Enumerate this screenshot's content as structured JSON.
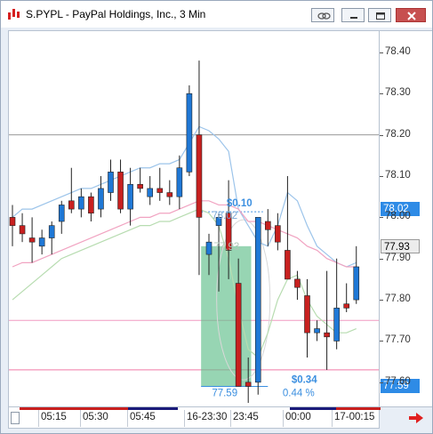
{
  "window": {
    "title": "S.PYPL - PayPal Holdings, Inc., 3 Min",
    "buttons": [
      "link-icon",
      "minimize-icon",
      "restore-icon",
      "close-icon"
    ]
  },
  "price_axis": {
    "ticks": [
      "78.40",
      "78.30",
      "78.20",
      "78.10",
      "78.00",
      "77.90",
      "77.80",
      "77.70",
      "77.60"
    ],
    "tags": {
      "blue_level": "78.02",
      "last_price": "77.93",
      "measure_low": "77.59"
    }
  },
  "time_axis": {
    "labels": [
      "05:15",
      "05:30",
      "05:45",
      "16-23:30",
      "23:45",
      "00:00",
      "17-00:15"
    ]
  },
  "measure_tool": {
    "top_change": "$0.10",
    "top_price": "78.02",
    "mid_price": "77.93",
    "bottom_change": "$0.34",
    "bottom_price": "77.59",
    "bottom_pct": "0.44 %"
  },
  "colors": {
    "up": "#1f78d6",
    "down": "#c8201f",
    "measure_fill": "#5fbf8a",
    "bollinger": "#9cc4ea",
    "ma_pink": "#f1a3c1",
    "ma_green": "#b7dcb0",
    "accent_tag": "#2e8be6"
  },
  "chart_data": {
    "type": "candlestick",
    "ylim": [
      77.55,
      78.43
    ],
    "candles": [
      {
        "o": 78.0,
        "h": 78.03,
        "l": 77.93,
        "c": 77.98
      },
      {
        "o": 77.98,
        "h": 78.01,
        "l": 77.94,
        "c": 77.96
      },
      {
        "o": 77.95,
        "h": 78.0,
        "l": 77.89,
        "c": 77.94
      },
      {
        "o": 77.93,
        "h": 77.97,
        "l": 77.91,
        "c": 77.95
      },
      {
        "o": 77.95,
        "h": 77.99,
        "l": 77.91,
        "c": 77.98
      },
      {
        "o": 77.99,
        "h": 78.04,
        "l": 77.96,
        "c": 78.03
      },
      {
        "o": 78.04,
        "h": 78.12,
        "l": 78.01,
        "c": 78.02
      },
      {
        "o": 78.02,
        "h": 78.07,
        "l": 78.0,
        "c": 78.05
      },
      {
        "o": 78.05,
        "h": 78.06,
        "l": 77.99,
        "c": 78.01
      },
      {
        "o": 78.02,
        "h": 78.1,
        "l": 78.0,
        "c": 78.07
      },
      {
        "o": 78.06,
        "h": 78.14,
        "l": 78.04,
        "c": 78.11
      },
      {
        "o": 78.11,
        "h": 78.14,
        "l": 78.01,
        "c": 78.02
      },
      {
        "o": 78.02,
        "h": 78.12,
        "l": 77.98,
        "c": 78.08
      },
      {
        "o": 78.08,
        "h": 78.12,
        "l": 78.06,
        "c": 78.07
      },
      {
        "o": 78.05,
        "h": 78.1,
        "l": 78.03,
        "c": 78.07
      },
      {
        "o": 78.07,
        "h": 78.12,
        "l": 78.04,
        "c": 78.06
      },
      {
        "o": 78.06,
        "h": 78.09,
        "l": 78.03,
        "c": 78.05
      },
      {
        "o": 78.05,
        "h": 78.15,
        "l": 78.02,
        "c": 78.12
      },
      {
        "o": 78.11,
        "h": 78.32,
        "l": 78.1,
        "c": 78.3
      },
      {
        "o": 78.2,
        "h": 78.38,
        "l": 77.86,
        "c": 78.0
      },
      {
        "o": 77.91,
        "h": 77.96,
        "l": 77.86,
        "c": 77.94
      },
      {
        "o": 77.98,
        "h": 78.01,
        "l": 77.82,
        "c": 78.0
      },
      {
        "o": 78.01,
        "h": 78.09,
        "l": 77.85,
        "c": 77.92
      },
      {
        "o": 77.84,
        "h": 77.9,
        "l": 77.63,
        "c": 77.59
      },
      {
        "o": 77.6,
        "h": 77.66,
        "l": 77.55,
        "c": 77.59
      },
      {
        "o": 77.6,
        "h": 77.98,
        "l": 77.57,
        "c": 78.0
      },
      {
        "o": 77.99,
        "h": 78.02,
        "l": 77.93,
        "c": 77.97
      },
      {
        "o": 77.98,
        "h": 78.01,
        "l": 77.92,
        "c": 77.94
      },
      {
        "o": 77.92,
        "h": 78.1,
        "l": 77.9,
        "c": 77.85
      },
      {
        "o": 77.85,
        "h": 77.87,
        "l": 77.8,
        "c": 77.83
      },
      {
        "o": 77.81,
        "h": 77.85,
        "l": 77.66,
        "c": 77.72
      },
      {
        "o": 77.72,
        "h": 77.75,
        "l": 77.7,
        "c": 77.73
      },
      {
        "o": 77.72,
        "h": 77.87,
        "l": 77.63,
        "c": 77.71
      },
      {
        "o": 77.7,
        "h": 77.9,
        "l": 77.68,
        "c": 77.78
      },
      {
        "o": 77.79,
        "h": 77.84,
        "l": 77.77,
        "c": 77.78
      },
      {
        "o": 77.8,
        "h": 77.93,
        "l": 77.79,
        "c": 77.88
      }
    ],
    "bollinger_upper": [
      78.0,
      78.02,
      78.02,
      78.03,
      78.04,
      78.05,
      78.06,
      78.07,
      78.07,
      78.08,
      78.09,
      78.1,
      78.11,
      78.12,
      78.12,
      78.13,
      78.13,
      78.14,
      78.18,
      78.22,
      78.21,
      78.19,
      78.16,
      78.02,
      77.98,
      77.94,
      77.93,
      77.98,
      78.06,
      78.04,
      77.98,
      77.93,
      77.91,
      77.89,
      77.88,
      77.89
    ],
    "ma_pink": [
      77.88,
      77.89,
      77.89,
      77.9,
      77.91,
      77.92,
      77.93,
      77.94,
      77.95,
      77.96,
      77.97,
      77.98,
      77.99,
      78.0,
      78.0,
      78.01,
      78.01,
      78.02,
      78.03,
      78.04,
      78.04,
      78.03,
      78.03,
      78.02,
      77.99,
      77.99,
      77.98,
      77.97,
      77.96,
      77.95,
      77.93,
      77.92,
      77.9,
      77.89,
      77.88,
      77.88
    ],
    "ma_green": [
      77.8,
      77.82,
      77.84,
      77.86,
      77.88,
      77.9,
      77.91,
      77.92,
      77.93,
      77.94,
      77.95,
      77.96,
      77.97,
      77.98,
      77.98,
      77.99,
      77.99,
      78.0,
      78.01,
      78.02,
      78.01,
      77.98,
      77.9,
      77.78,
      77.68,
      77.66,
      77.72,
      77.8,
      77.85,
      77.86,
      77.8,
      77.76,
      77.74,
      77.72,
      77.72,
      77.73
    ],
    "hlines": [
      {
        "y": 78.2,
        "color": "#9a9a9a"
      },
      {
        "y": 77.75,
        "color": "#f09ac0"
      },
      {
        "y": 77.63,
        "color": "#f07aa8"
      },
      {
        "y": 77.53,
        "color": "#f09ac0"
      }
    ]
  }
}
